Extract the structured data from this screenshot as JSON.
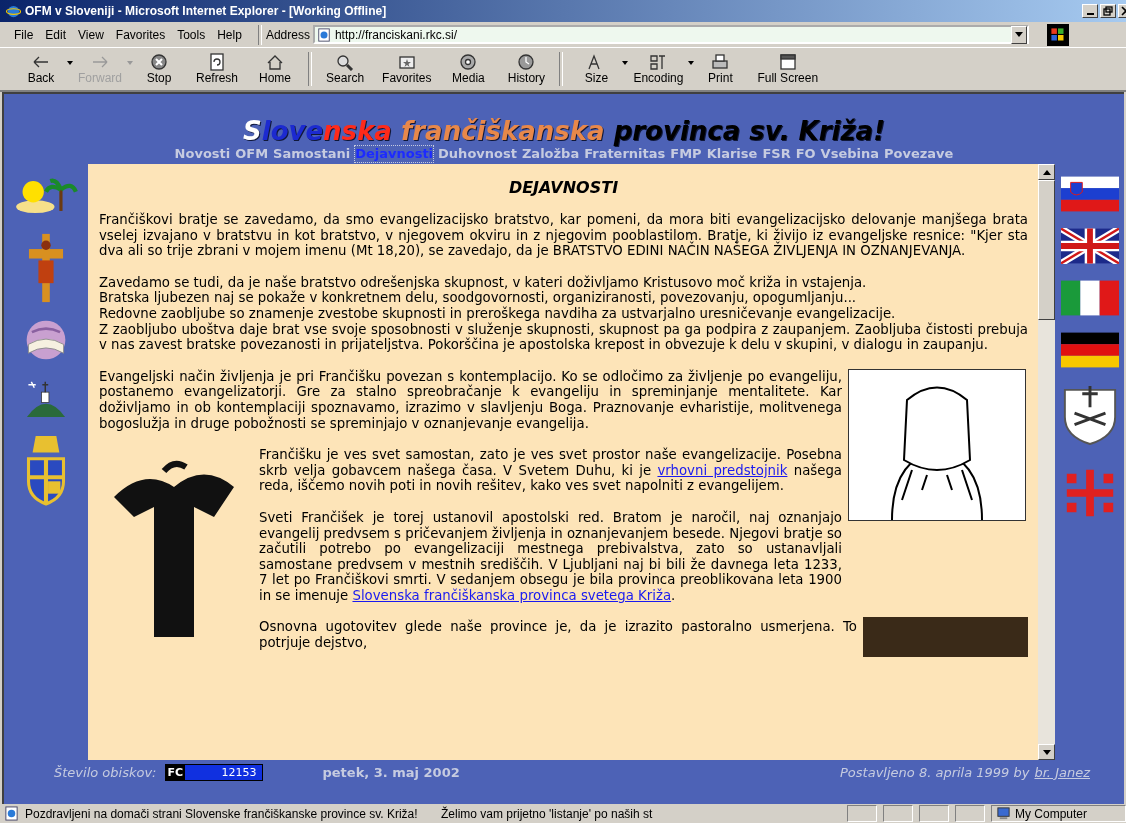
{
  "window": {
    "title": "OFM v Sloveniji - Microsoft Internet Explorer - [Working Offline]"
  },
  "menu": [
    "File",
    "Edit",
    "View",
    "Favorites",
    "Tools",
    "Help"
  ],
  "address": {
    "label": "Address",
    "value": "http://franciskani.rkc.si/"
  },
  "toolbar": [
    {
      "label": "Back",
      "kind": "back",
      "disabled": false,
      "dropdown": true
    },
    {
      "label": "Forward",
      "kind": "forward",
      "disabled": true,
      "dropdown": true
    },
    {
      "label": "Stop",
      "kind": "stop",
      "disabled": false,
      "dropdown": false
    },
    {
      "label": "Refresh",
      "kind": "refresh",
      "disabled": false,
      "dropdown": false
    },
    {
      "label": "Home",
      "kind": "home",
      "disabled": false,
      "dropdown": false
    },
    {
      "label": "Search",
      "kind": "search",
      "disabled": false,
      "dropdown": false
    },
    {
      "label": "Favorites",
      "kind": "favorites",
      "disabled": false,
      "dropdown": false
    },
    {
      "label": "Media",
      "kind": "media",
      "disabled": false,
      "dropdown": false
    },
    {
      "label": "History",
      "kind": "history",
      "disabled": false,
      "dropdown": false
    },
    {
      "label": "Size",
      "kind": "size",
      "disabled": false,
      "dropdown": true
    },
    {
      "label": "Encoding",
      "kind": "encoding",
      "disabled": false,
      "dropdown": true
    },
    {
      "label": "Print",
      "kind": "print",
      "disabled": false,
      "dropdown": false
    },
    {
      "label": "Full Screen",
      "kind": "fullscreen",
      "disabled": false,
      "dropdown": false
    }
  ],
  "page": {
    "title_parts": [
      {
        "text": "S",
        "color": "#ffffff"
      },
      {
        "text": "love",
        "color": "#1c2ad0"
      },
      {
        "text": "nska ",
        "color": "#ff2a1a"
      },
      {
        "text": "frančiškanska ",
        "color": "#e8884a"
      },
      {
        "text": "provinca sv. Križa!",
        "color": "#000000"
      }
    ],
    "nav": [
      {
        "label": "Novosti",
        "selected": false
      },
      {
        "label": "OFM",
        "selected": false
      },
      {
        "label": "Samostani",
        "selected": false
      },
      {
        "label": "Dejavnosti",
        "selected": true
      },
      {
        "label": "Duhovnost",
        "selected": false
      },
      {
        "label": "Založba",
        "selected": false
      },
      {
        "label": "Fraternitas",
        "selected": false
      },
      {
        "label": "FMP",
        "selected": false
      },
      {
        "label": "Klarise",
        "selected": false
      },
      {
        "label": "FSR",
        "selected": false
      },
      {
        "label": "FO",
        "selected": false
      },
      {
        "label": "Vsebina",
        "selected": false
      },
      {
        "label": "Povezave",
        "selected": false
      }
    ],
    "heading": "DEJAVNOSTI",
    "paragraphs": [
      {
        "parts": [
          {
            "text": "Frančiškovi bratje se zavedamo, da smo evangelizacijsko bratstvo, kar pomeni, da mora biti evangelizacijsko delovanje manjšega brata vselej izvajano v bratstvu in kot bratstvo, v njegovem okviru in z njegovim pooblastilom. Bratje, ki živijo iz evangeljske resnice: \"Kjer sta dva ali so trije zbrani v mojem imenu (Mt 18,20), se zavedajo, da je BRATSTVO EDINI NAČIN NAŠEGA ŽIVLJENJA IN OZNANJEVANJA."
          }
        ]
      },
      {
        "parts": [
          {
            "text": "Zavedamo se tudi, da je naše bratstvo odrešenjska skupnost, v kateri doživljamo Kristusovo moč križa in vstajenja."
          }
        ]
      },
      {
        "parts": [
          {
            "text": "Bratska ljubezen naj se pokaže v konkretnem delu, soodgovornosti, organiziranosti, povezovanju, opogumljanju..."
          }
        ]
      },
      {
        "parts": [
          {
            "text": "Redovne zaobljube so znamenje zvestobe skupnosti in preroškega navdiha za ustvarjalno uresničevanje evangelizacije."
          }
        ]
      },
      {
        "parts": [
          {
            "text": "Z zaobljubo uboštva daje brat vse svoje sposobnosti v služenje skupnosti, skupnost pa ga podpira z zaupanjem. Zaobljuba čistosti prebuja v nas zavest bratske povezanosti in prijateljstva. Pokorščina je apostolska krepost in obvezuje k delu v skupini, v dialogu in zaupanju."
          }
        ]
      },
      {
        "parts": [
          {
            "text": "Evangeljski način življenja je pri Frančišku povezan s kontemplacijo. Ko se odločimo za življenje po evangeliju, postanemo evangelizatorji. Gre za stalno spreobračanje k evangeliju in spreminjanje mentalitete. Kar doživljamo in ob kontemplaciji spoznavamo, izrazimo v slavljenju Boga. Praznovanje evharistije, molitvenega bogoslužja in druge pobožnosti se spreminjajo v oznanjevanje evangelija."
          }
        ]
      },
      {
        "parts": [
          {
            "text": "Frančišku je ves svet samostan, zato je ves svet prostor naše evangelizacije. Posebna skrb velja gobavcem našega časa. V Svetem Duhu, ki je "
          },
          {
            "link": "vrhovni predstojnik"
          },
          {
            "text": " našega reda, iščemo novih poti in novih rešitev, kako ves svet napolniti z evangelijem."
          }
        ]
      },
      {
        "parts": [
          {
            "text": "Sveti Frančišek je torej ustanovil apostolski red. Bratom je naročil, naj oznanjajo evangelij predvsem s pričevanjem življenja in oznanjevanjem besede. Njegovi bratje so začutili potrebo po evangelizaciji mestnega prebivalstva, zato so ustanavljali samostane predvsem v mestnih središčih. V Ljubljani naj bi bili že davnega leta 1233, 7 let po Frančiškovi smrti. V sedanjem obsegu je bila provinca preoblikovana leta 1900 in se imenuje "
          },
          {
            "link": "Slovenska frančiškanska provinca svetega Križa"
          },
          {
            "text": "."
          }
        ]
      },
      {
        "parts": [
          {
            "text": "Osnovna ugotovitev glede naše province je, da je izrazito pastoralno usmerjena. To potrjuje dejstvo,"
          }
        ]
      }
    ],
    "footer": {
      "counter_label": "Število obiskov:",
      "counter_badge": "FC",
      "counter_value": "12153",
      "date": "petek, 3. maj 2002",
      "posted": "Postavljeno 8. aprila 1999 by",
      "author": "br. Janez"
    }
  },
  "status_bar": {
    "message": "Pozdravljeni na domači strani Slovenske frančiškanske province sv. Križa!",
    "scroller": "Želimo vam prijetno 'listanje' po naših st",
    "zone": "My Computer"
  }
}
